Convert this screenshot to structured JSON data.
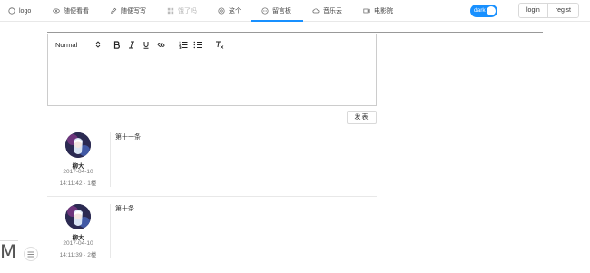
{
  "nav": {
    "items": [
      {
        "label": "logo",
        "icon": "circle-icon",
        "disabled": false
      },
      {
        "label": "随便看看",
        "icon": "eye-icon",
        "disabled": false
      },
      {
        "label": "随便写写",
        "icon": "edit-icon",
        "disabled": false
      },
      {
        "label": "饿了吗",
        "icon": "grid-icon",
        "disabled": true
      },
      {
        "label": "这个",
        "icon": "target-icon",
        "disabled": false
      },
      {
        "label": "留言板",
        "icon": "message-icon",
        "disabled": false,
        "active": true
      },
      {
        "label": "音乐云",
        "icon": "cloud-icon",
        "disabled": false
      },
      {
        "label": "电影院",
        "icon": "video-icon",
        "disabled": false
      }
    ],
    "theme_toggle": {
      "label": "dark",
      "on": true
    },
    "login_label": "login",
    "register_label": "regist"
  },
  "editor": {
    "format_select": "Normal",
    "send_label": "发表"
  },
  "comments": [
    {
      "author": "柳大",
      "date": "2017-04-10",
      "time": "14:11:42",
      "floor": "1楼",
      "text": "第十一条"
    },
    {
      "author": "柳大",
      "date": "2017-04-10",
      "time": "14:11:39",
      "floor": "2楼",
      "text": "第十条"
    }
  ],
  "footer": {
    "logo_letter": "M"
  },
  "colors": {
    "accent": "#1890ff"
  }
}
